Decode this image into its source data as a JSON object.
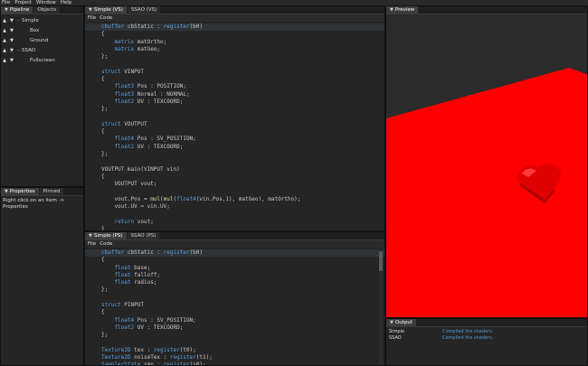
{
  "menubar": [
    "File",
    "Project",
    "Window",
    "Help"
  ],
  "pipeline_panel": {
    "tabs": [
      "Pipeline",
      "Objects"
    ],
    "items": [
      {
        "label": "Simple",
        "level": 0,
        "expander": "-"
      },
      {
        "label": "Box",
        "level": 1
      },
      {
        "label": "Ground",
        "level": 1
      },
      {
        "label": "SSAO",
        "level": 0,
        "expander": "-"
      },
      {
        "label": "Fullscreen",
        "level": 1
      }
    ]
  },
  "properties_panel": {
    "tabs": [
      "Properties",
      "Pinned"
    ],
    "hint": "Right click on an item -> Properties"
  },
  "vs_editor": {
    "tabs": [
      "Simple (VS)",
      "SSAO (VS)"
    ],
    "menu": [
      "File",
      "Code"
    ],
    "lines": [
      "cbuffer cbStatic : register(b0)",
      "{",
      "    matrix matOrtho;",
      "    matrix matGeo;",
      "};",
      "",
      "struct VINPUT",
      "{",
      "    float3 Pos : POSITION;",
      "    float3 Normal : NORMAL;",
      "    float2 UV : TEXCOORD;",
      "};",
      "",
      "struct VOUTPUT",
      "{",
      "    float4 Pos : SV_POSITION;",
      "    float2 UV : TEXCOORD;",
      "};",
      "",
      "VOUTPUT main(VINPUT vin)",
      "{",
      "    VOUTPUT vout;",
      "",
      "    vout.Pos = mul(mul(float4(vin.Pos,1), matGeo), matOrtho);",
      "    vout.UV = vin.UV;",
      "",
      "    return vout;",
      "}"
    ]
  },
  "ps_editor": {
    "tabs": [
      "Simple (PS)",
      "SSAO (PS)"
    ],
    "menu": [
      "File",
      "Code"
    ],
    "lines": [
      "cbuffer cbStatic : register(b0)",
      "{",
      "    float base;",
      "    float falloff;",
      "    float radius;",
      "};",
      "",
      "struct PINPUT",
      "{",
      "    float4 Pos : SV_POSITION;",
      "    float2 UV : TEXCOORD;",
      "};",
      "",
      "Texture2D tex : register(t0);",
      "Texture2D noiseTex : register(t1);",
      "SamplerState smp : register(s0);"
    ]
  },
  "preview_panel": {
    "tab": "Preview",
    "cube_color": "#ff0000"
  },
  "output_panel": {
    "tab": "Output",
    "rows": [
      {
        "source": "Simple",
        "message": "Compiled the shaders."
      },
      {
        "source": "SSAO",
        "message": "Compiled the shaders."
      }
    ]
  }
}
